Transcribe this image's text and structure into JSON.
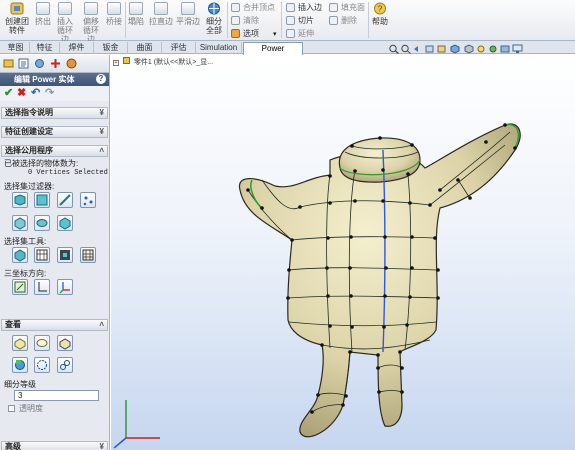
{
  "ribbon": {
    "create_label": "创建团 转件",
    "extrude_label": "挤出",
    "loft_label": "插入循环边",
    "offset_loop_label": "偏移循环边",
    "bridge_label": "桥接",
    "collapse_label": "塌陷",
    "straighten_label": "拉直边",
    "flatten_label": "平滑边",
    "subdivide_all_label": "细分全部",
    "merge_vertex_label": "合并顶点",
    "delete_label": "清除",
    "options_label": "选项",
    "insert_edge_label": "插入边",
    "fill_label": "填充面",
    "cut_label": "切片",
    "remove_label": "删除",
    "extend_label": "延伸",
    "help_label": "帮助"
  },
  "tabs": [
    {
      "label": "草图"
    },
    {
      "label": "特征"
    },
    {
      "label": "焊件"
    },
    {
      "label": "钣金"
    },
    {
      "label": "曲面"
    },
    {
      "label": "评估"
    },
    {
      "label": "Simulation"
    },
    {
      "label": "Power Surfacing"
    }
  ],
  "panel": {
    "title": "编辑 Power 实体",
    "help": "?",
    "sections": {
      "cmd_note": "选择指令说明",
      "feature_settings": "特征创建设定",
      "select_filter": "选择公用程序",
      "view": "查看",
      "advanced": "高级"
    },
    "selected_count_label": "已被选择的物体数为:",
    "selected_value": "0 Vertices Selected",
    "filter_label": "选择集过滤器:",
    "select_tool_label": "选择集工具:",
    "triad_label": "三坐标方向:",
    "subdiv_label": "细分等级",
    "subdiv_value": "3",
    "transparency_label": "透明度"
  },
  "viewport": {
    "tree_label": "零件1 (默认<<默认>_显..."
  },
  "colors": {
    "accent": "#3f5477",
    "model_fill": "#d7d0a6",
    "wire": "#1e2a1e",
    "center_line": "#2a5bd8",
    "green_edge": "#2f9b2f",
    "axis_red": "#d11a1a"
  }
}
